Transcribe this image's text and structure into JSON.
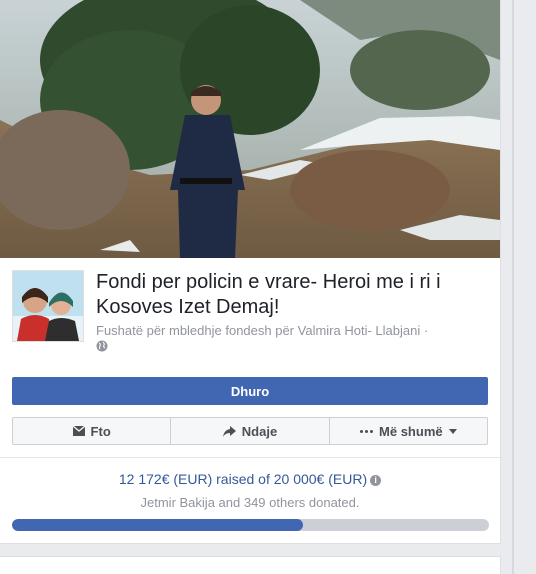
{
  "fundraiser": {
    "title": "Fondi per policin e vrare- Heroi me i ri i Kosoves Izet Demaj!",
    "subtitle": "Fushatë për mbledhje fondesh për Valmira Hoti- Llabjani ·",
    "privacy_icon": "globe-icon",
    "donate_label": "Dhuro",
    "actions": [
      {
        "label": "Fto",
        "icon": "envelope-icon"
      },
      {
        "label": "Ndaje",
        "icon": "share-arrow-icon"
      },
      {
        "label": "Më shumë",
        "icon": "ellipsis-icon"
      }
    ],
    "raised_text": "12 172€ (EUR) raised of 20 000€ (EUR)",
    "donors_text": "Jetmir Bakija and 349 others donated.",
    "progress_fraction": 0.61
  },
  "colors": {
    "accent": "#4267b2",
    "link": "#365899",
    "muted": "#90949c",
    "track": "#ccd0d5"
  }
}
